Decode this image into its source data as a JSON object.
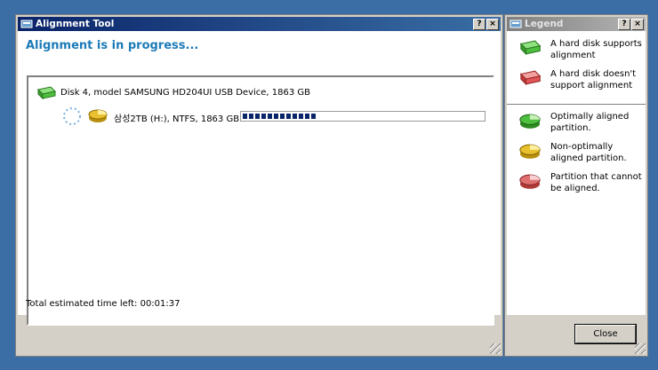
{
  "alignment_window": {
    "title": "Alignment Tool",
    "help_label": "?",
    "close_label": "×",
    "heading": "Alignment is in progress...",
    "disk_label": "Disk 4, model SAMSUNG HD204UI USB Device, 1863 GB",
    "partition_label": "삼성2TB (H:), NTFS, 1863 GB",
    "progress_fraction": 0.3,
    "eta": "Total estimated time left: 00:01:37"
  },
  "legend_window": {
    "title": "Legend",
    "help_label": "?",
    "close_label": "×",
    "items": [
      {
        "label": "A hard disk supports alignment",
        "icon": "disk-supported-icon"
      },
      {
        "label": "A hard disk doesn't support alignment",
        "icon": "disk-unsupported-icon"
      },
      {
        "label": "Optimally aligned partition.",
        "icon": "partition-optimal-icon"
      },
      {
        "label": "Non-optimally aligned partition.",
        "icon": "partition-nonoptimal-icon"
      },
      {
        "label": "Partition that cannot be aligned.",
        "icon": "partition-unalignable-icon"
      }
    ],
    "close_button_label": "Close"
  },
  "colors": {
    "heading": "#1c7bb8",
    "desktop": "#3a6ea5",
    "titlebar_active": "#0a246a",
    "progress_fill": "#0a246a",
    "disk_green": "#4fbf3f",
    "disk_red": "#e05555",
    "partition_gold": "#d8b020"
  }
}
